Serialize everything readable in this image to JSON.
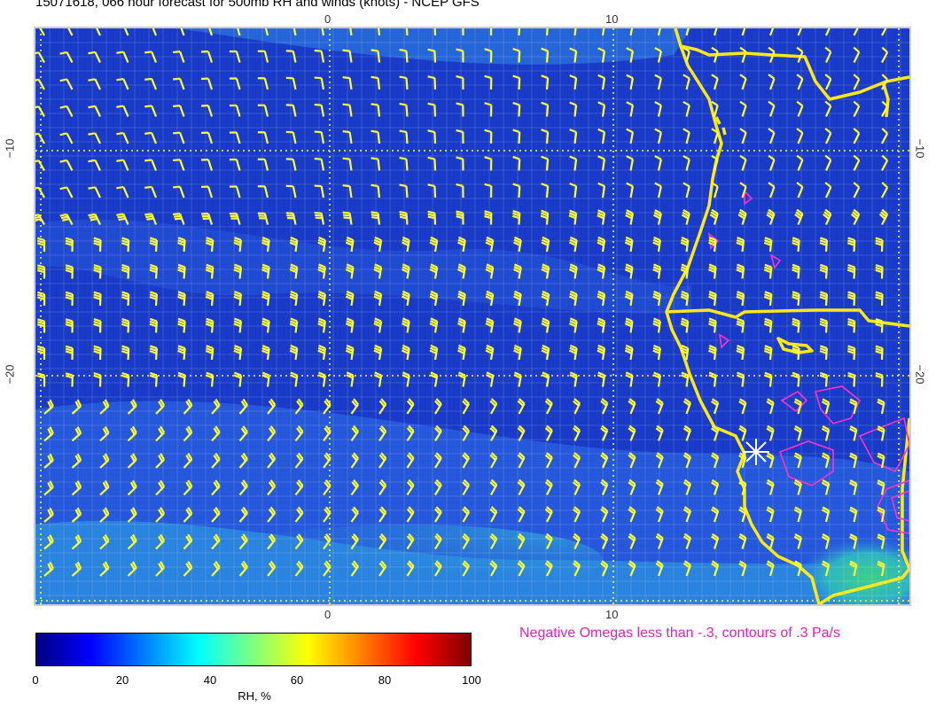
{
  "title": "15071618, 066 hour forecast for 500mb RH and winds (knots) - NCEP GFS",
  "map": {
    "top_ticks": [
      "0",
      "10"
    ],
    "bottom_ticks": [
      "0",
      "10"
    ],
    "left_ticks": [
      "−10",
      "−20"
    ],
    "right_ticks": [
      "−10",
      "−20"
    ],
    "background_color": "#1a3bc8",
    "barb_color": "#ffff33",
    "coast_color": "#ffe81a",
    "omega_contour_color": "#ff33cc",
    "marker_icon": "asterisk-marker"
  },
  "omega_note": {
    "text": "Negative Omegas less than -.3, contours of .3 Pa/s",
    "color": "#e020c0"
  },
  "colorbar": {
    "label": "RH, %",
    "ticks": [
      "0",
      "20",
      "40",
      "60",
      "80",
      "100"
    ],
    "min": 0,
    "max": 100,
    "colors": [
      "#00007f",
      "#0000ff",
      "#007fff",
      "#00ffff",
      "#7fff7f",
      "#ffff00",
      "#ff7f00",
      "#ff0000",
      "#7f0000"
    ]
  }
}
